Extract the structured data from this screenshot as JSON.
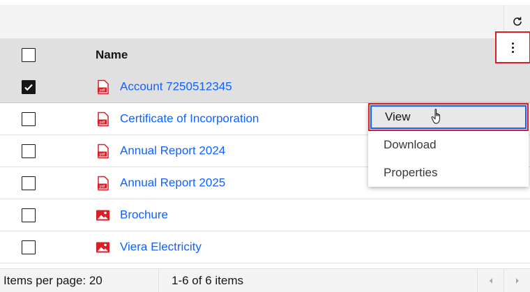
{
  "toolbar": {
    "refresh_icon": "refresh-icon"
  },
  "table": {
    "column_name": "Name",
    "rows": [
      {
        "name": "Account 7250512345",
        "type": "pdf",
        "checked": true
      },
      {
        "name": "Certificate of Incorporation",
        "type": "pdf",
        "checked": false
      },
      {
        "name": "Annual Report 2024",
        "type": "pdf",
        "checked": false
      },
      {
        "name": "Annual Report 2025",
        "type": "pdf",
        "checked": false
      },
      {
        "name": "Brochure",
        "type": "image",
        "checked": false
      },
      {
        "name": "Viera Electricity",
        "type": "image",
        "checked": false
      }
    ]
  },
  "menu": {
    "items": [
      "View",
      "Download",
      "Properties"
    ],
    "hovered": "View"
  },
  "footer": {
    "items_per_page": "Items per page: 20",
    "range": "1-6 of 6 items"
  },
  "colors": {
    "link": "#0f62fe",
    "highlight": "#da1e28",
    "pdf": "#da1e28"
  }
}
